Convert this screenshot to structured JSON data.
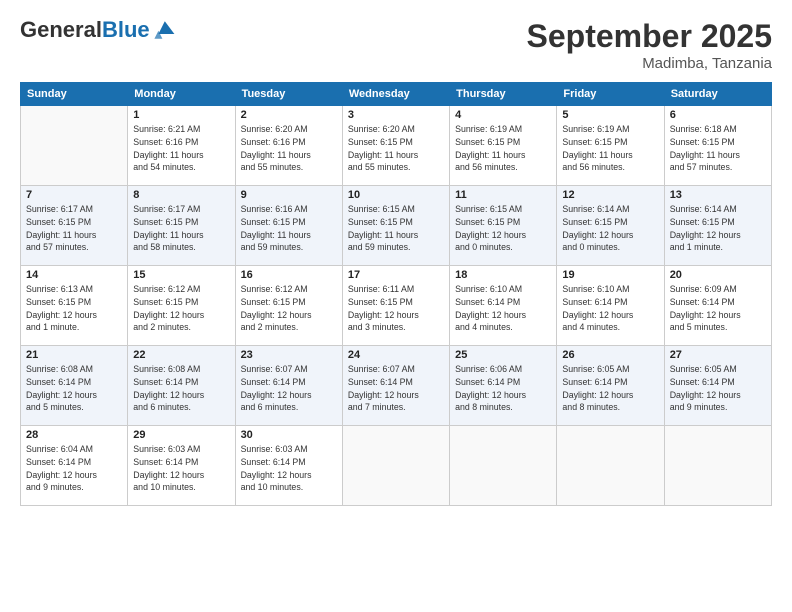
{
  "logo": {
    "general": "General",
    "blue": "Blue"
  },
  "title": "September 2025",
  "subtitle": "Madimba, Tanzania",
  "days_header": [
    "Sunday",
    "Monday",
    "Tuesday",
    "Wednesday",
    "Thursday",
    "Friday",
    "Saturday"
  ],
  "weeks": [
    [
      {
        "num": "",
        "info": ""
      },
      {
        "num": "1",
        "info": "Sunrise: 6:21 AM\nSunset: 6:16 PM\nDaylight: 11 hours\nand 54 minutes."
      },
      {
        "num": "2",
        "info": "Sunrise: 6:20 AM\nSunset: 6:16 PM\nDaylight: 11 hours\nand 55 minutes."
      },
      {
        "num": "3",
        "info": "Sunrise: 6:20 AM\nSunset: 6:15 PM\nDaylight: 11 hours\nand 55 minutes."
      },
      {
        "num": "4",
        "info": "Sunrise: 6:19 AM\nSunset: 6:15 PM\nDaylight: 11 hours\nand 56 minutes."
      },
      {
        "num": "5",
        "info": "Sunrise: 6:19 AM\nSunset: 6:15 PM\nDaylight: 11 hours\nand 56 minutes."
      },
      {
        "num": "6",
        "info": "Sunrise: 6:18 AM\nSunset: 6:15 PM\nDaylight: 11 hours\nand 57 minutes."
      }
    ],
    [
      {
        "num": "7",
        "info": "Sunrise: 6:17 AM\nSunset: 6:15 PM\nDaylight: 11 hours\nand 57 minutes."
      },
      {
        "num": "8",
        "info": "Sunrise: 6:17 AM\nSunset: 6:15 PM\nDaylight: 11 hours\nand 58 minutes."
      },
      {
        "num": "9",
        "info": "Sunrise: 6:16 AM\nSunset: 6:15 PM\nDaylight: 11 hours\nand 59 minutes."
      },
      {
        "num": "10",
        "info": "Sunrise: 6:15 AM\nSunset: 6:15 PM\nDaylight: 11 hours\nand 59 minutes."
      },
      {
        "num": "11",
        "info": "Sunrise: 6:15 AM\nSunset: 6:15 PM\nDaylight: 12 hours\nand 0 minutes."
      },
      {
        "num": "12",
        "info": "Sunrise: 6:14 AM\nSunset: 6:15 PM\nDaylight: 12 hours\nand 0 minutes."
      },
      {
        "num": "13",
        "info": "Sunrise: 6:14 AM\nSunset: 6:15 PM\nDaylight: 12 hours\nand 1 minute."
      }
    ],
    [
      {
        "num": "14",
        "info": "Sunrise: 6:13 AM\nSunset: 6:15 PM\nDaylight: 12 hours\nand 1 minute."
      },
      {
        "num": "15",
        "info": "Sunrise: 6:12 AM\nSunset: 6:15 PM\nDaylight: 12 hours\nand 2 minutes."
      },
      {
        "num": "16",
        "info": "Sunrise: 6:12 AM\nSunset: 6:15 PM\nDaylight: 12 hours\nand 2 minutes."
      },
      {
        "num": "17",
        "info": "Sunrise: 6:11 AM\nSunset: 6:15 PM\nDaylight: 12 hours\nand 3 minutes."
      },
      {
        "num": "18",
        "info": "Sunrise: 6:10 AM\nSunset: 6:14 PM\nDaylight: 12 hours\nand 4 minutes."
      },
      {
        "num": "19",
        "info": "Sunrise: 6:10 AM\nSunset: 6:14 PM\nDaylight: 12 hours\nand 4 minutes."
      },
      {
        "num": "20",
        "info": "Sunrise: 6:09 AM\nSunset: 6:14 PM\nDaylight: 12 hours\nand 5 minutes."
      }
    ],
    [
      {
        "num": "21",
        "info": "Sunrise: 6:08 AM\nSunset: 6:14 PM\nDaylight: 12 hours\nand 5 minutes."
      },
      {
        "num": "22",
        "info": "Sunrise: 6:08 AM\nSunset: 6:14 PM\nDaylight: 12 hours\nand 6 minutes."
      },
      {
        "num": "23",
        "info": "Sunrise: 6:07 AM\nSunset: 6:14 PM\nDaylight: 12 hours\nand 6 minutes."
      },
      {
        "num": "24",
        "info": "Sunrise: 6:07 AM\nSunset: 6:14 PM\nDaylight: 12 hours\nand 7 minutes."
      },
      {
        "num": "25",
        "info": "Sunrise: 6:06 AM\nSunset: 6:14 PM\nDaylight: 12 hours\nand 8 minutes."
      },
      {
        "num": "26",
        "info": "Sunrise: 6:05 AM\nSunset: 6:14 PM\nDaylight: 12 hours\nand 8 minutes."
      },
      {
        "num": "27",
        "info": "Sunrise: 6:05 AM\nSunset: 6:14 PM\nDaylight: 12 hours\nand 9 minutes."
      }
    ],
    [
      {
        "num": "28",
        "info": "Sunrise: 6:04 AM\nSunset: 6:14 PM\nDaylight: 12 hours\nand 9 minutes."
      },
      {
        "num": "29",
        "info": "Sunrise: 6:03 AM\nSunset: 6:14 PM\nDaylight: 12 hours\nand 10 minutes."
      },
      {
        "num": "30",
        "info": "Sunrise: 6:03 AM\nSunset: 6:14 PM\nDaylight: 12 hours\nand 10 minutes."
      },
      {
        "num": "",
        "info": ""
      },
      {
        "num": "",
        "info": ""
      },
      {
        "num": "",
        "info": ""
      },
      {
        "num": "",
        "info": ""
      }
    ]
  ]
}
